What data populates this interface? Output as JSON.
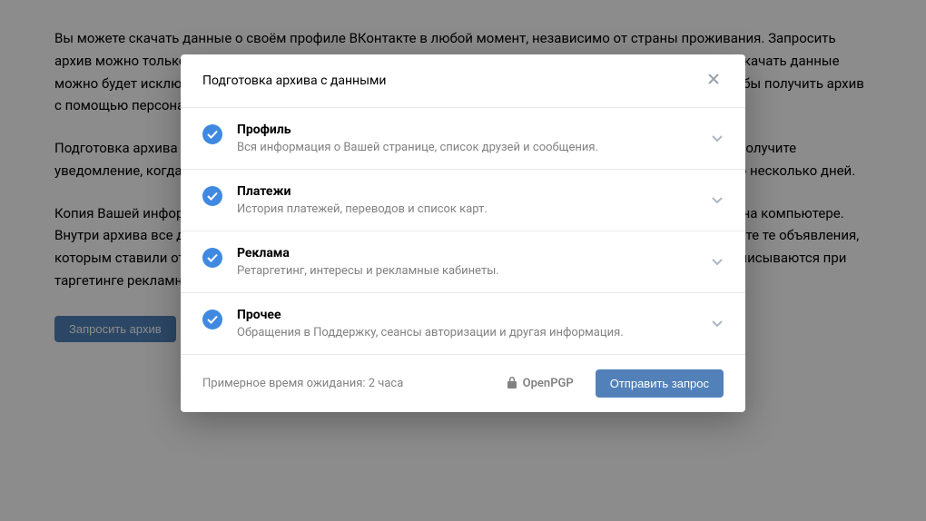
{
  "background": {
    "p1": "Вы можете скачать данные о своём профиле ВКонтакте в любой момент, независимо от страны проживания. Запросить архив можно только самостоятельно: потребуется подтвердить с помощью одноразового кода из SMS, а скачать данные можно будет исключительно из другого профиля. Вы также можете указать публичный ключ OpenPGP, чтобы получить архив с помощью персонального шифрования.",
    "p2": "Подготовка архива займёт какое-то время — возможно, несколько минут, — а может, несколько дней. Вы получите уведомление, когда архив будет готов. Для защиты и безопасности Ваших данных он будет доступен всего несколько дней.",
    "p3": "Копия Вашей информации будет доступна в архиве ZIP с файлами HTML, чтобы данные удобнее смотреть на компьютере. Внутри архива все данные будут разложены на разные категории. Например, в разделе рекламы Вы увидите те объявления, которым ставили отметку «Нравится», историю действий с рекламой, а также интересы, которые Вам приписываются при таргетинге рекламных объявлений.",
    "request_btn": "Запросить архив"
  },
  "modal": {
    "title": "Подготовка архива с данными",
    "categories": [
      {
        "title": "Профиль",
        "desc": "Вся информация о Вашей странице, список друзей и сообщения."
      },
      {
        "title": "Платежи",
        "desc": "История платежей, переводов и список карт."
      },
      {
        "title": "Реклама",
        "desc": "Ретаргетинг, интересы и рекламные кабинеты."
      },
      {
        "title": "Прочее",
        "desc": "Обращения в Поддержку, сеансы авторизации и другая информация."
      }
    ],
    "wait_label": "Примерное время ожидания:",
    "wait_value": "2 часа",
    "openpgp": "OpenPGP",
    "submit": "Отправить запрос"
  }
}
